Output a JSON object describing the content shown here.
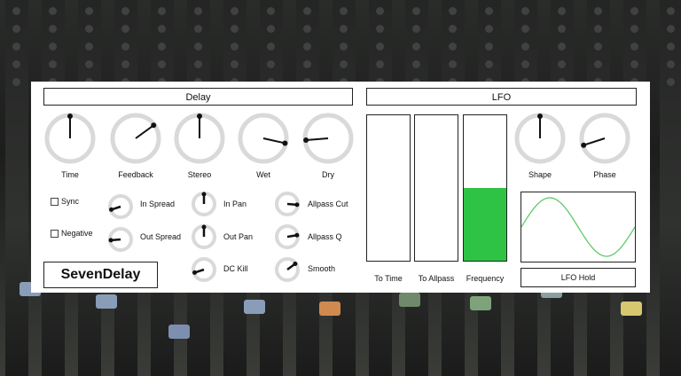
{
  "colors": {
    "fill_green": "#2fc345",
    "knob_ring": "#d9d9d9",
    "pointer": "#111111",
    "wave": "#5fca6a"
  },
  "delay": {
    "header": "Delay",
    "big_knobs": [
      {
        "label": "Time",
        "value": 0.5
      },
      {
        "label": "Feedback",
        "value": 0.7
      },
      {
        "label": "Stereo",
        "value": 0.5
      },
      {
        "label": "Wet",
        "value": 0.88
      },
      {
        "label": "Dry",
        "value": 0.15
      }
    ],
    "checkboxes": [
      {
        "label": "Sync",
        "checked": false
      },
      {
        "label": "Negative",
        "checked": false
      }
    ],
    "small_knobs": [
      {
        "label": "In Spread",
        "value": 0.1
      },
      {
        "label": "Out Spread",
        "value": 0.15
      },
      {
        "label": "In Pan",
        "value": 0.5
      },
      {
        "label": "Out Pan",
        "value": 0.5
      },
      {
        "label": "DC Kill",
        "value": 0.1
      },
      {
        "label": "Allpass Cut",
        "value": 0.85
      },
      {
        "label": "Allpass Q",
        "value": 0.8
      },
      {
        "label": "Smooth",
        "value": 0.7
      }
    ],
    "brand": "SevenDelay"
  },
  "lfo": {
    "header": "LFO",
    "bars": [
      {
        "label": "To Time",
        "level": 0.0
      },
      {
        "label": "To Allpass",
        "level": 0.0
      },
      {
        "label": "Frequency",
        "level": 0.5
      }
    ],
    "knobs": [
      {
        "label": "Shape",
        "value": 0.5
      },
      {
        "label": "Phase",
        "value": 0.1
      }
    ],
    "hold_label": "LFO Hold"
  }
}
